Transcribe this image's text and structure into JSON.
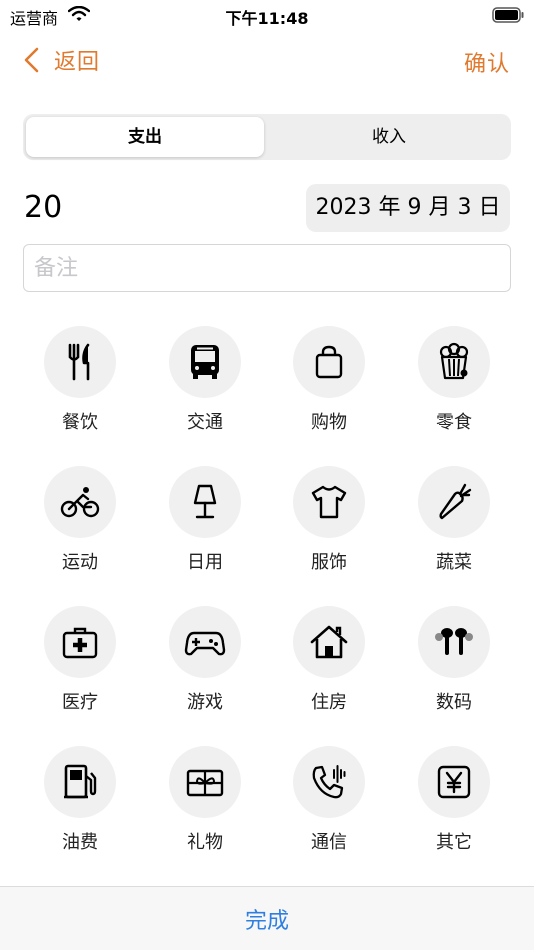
{
  "status": {
    "carrier": "运营商",
    "time": "下午11:48"
  },
  "nav": {
    "back_label": "返回",
    "confirm_label": "确认"
  },
  "segments": {
    "expense": "支出",
    "income": "收入",
    "selected": "支出"
  },
  "entry": {
    "amount": "20",
    "date": "2023 年 9 月 3 日",
    "note_placeholder": "备注",
    "note_value": ""
  },
  "categories": [
    {
      "label": "餐饮",
      "icon": "fork-knife-icon"
    },
    {
      "label": "交通",
      "icon": "bus-icon"
    },
    {
      "label": "购物",
      "icon": "shopping-bag-icon"
    },
    {
      "label": "零食",
      "icon": "popcorn-icon"
    },
    {
      "label": "运动",
      "icon": "bicycle-icon"
    },
    {
      "label": "日用",
      "icon": "lamp-icon"
    },
    {
      "label": "服饰",
      "icon": "tshirt-icon"
    },
    {
      "label": "蔬菜",
      "icon": "carrot-icon"
    },
    {
      "label": "医疗",
      "icon": "medical-kit-icon"
    },
    {
      "label": "游戏",
      "icon": "gamepad-icon"
    },
    {
      "label": "住房",
      "icon": "house-icon"
    },
    {
      "label": "数码",
      "icon": "earbuds-icon"
    },
    {
      "label": "油费",
      "icon": "fuel-pump-icon"
    },
    {
      "label": "礼物",
      "icon": "gift-card-icon"
    },
    {
      "label": "通信",
      "icon": "phone-waves-icon"
    },
    {
      "label": "其它",
      "icon": "yen-sign-icon"
    }
  ],
  "footer": {
    "done_label": "完成"
  },
  "colors": {
    "accent": "#E07A2F",
    "done": "#2F7FE0",
    "icon_bg": "#F0F0F0"
  }
}
